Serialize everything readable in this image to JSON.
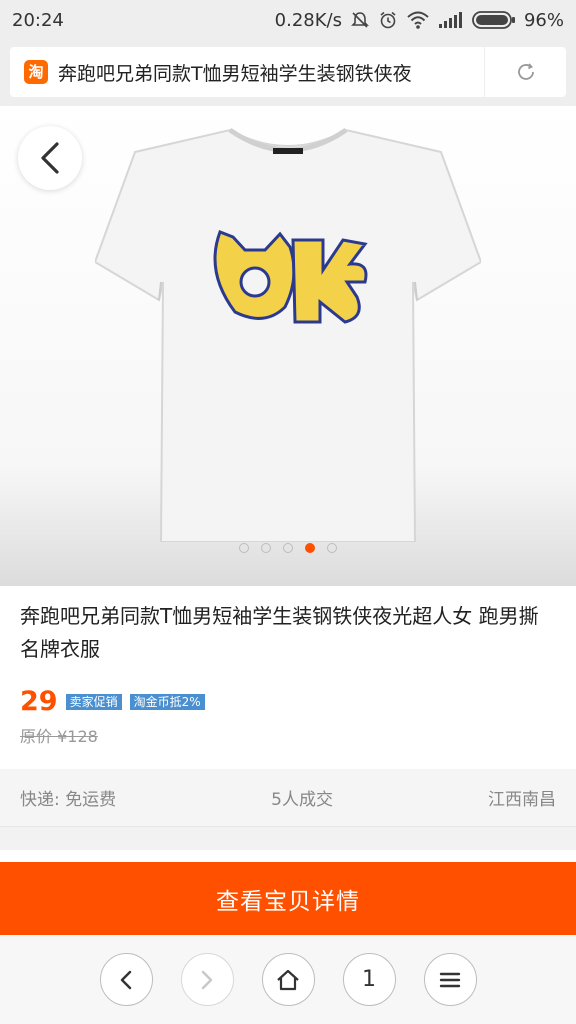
{
  "status_bar": {
    "time": "20:24",
    "speed": "0.28K/s",
    "battery": "96%"
  },
  "url_bar": {
    "logo_char": "淘",
    "title": "奔跑吧兄弟同款T恤男短袖学生装钢铁侠夜"
  },
  "gallery": {
    "total_images": 5,
    "active_index": 3
  },
  "product": {
    "title": "奔跑吧兄弟同款T恤男短袖学生装钢铁侠夜光超人女 跑男撕名牌衣服",
    "price": "29",
    "badges": [
      "卖家促销",
      "淘金币抵2%"
    ],
    "original_price": "原价 ¥128"
  },
  "meta": {
    "shipping": "快递: 免运费",
    "sales": "5人成交",
    "location": "江西南昌"
  },
  "cta": {
    "label": "查看宝贝详情"
  },
  "bottom_nav": {
    "tab_count": "1"
  },
  "colors": {
    "accent": "#ff5000",
    "badge": "#4a8fd0"
  }
}
